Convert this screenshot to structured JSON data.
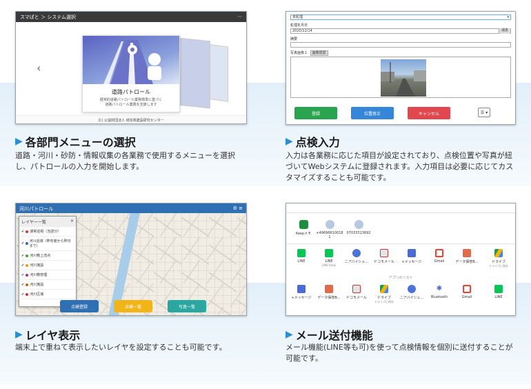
{
  "q1": {
    "breadcrumb": "スマぱと ＞ システム選択",
    "card_title": "道路パトロール",
    "card_sub": "経常的道路パトロール業務標準に基づく\n道路パトロール業務を支援します",
    "footer": "(C) 公益財団法人 岐阜県建設研究センター",
    "heading": "各部門メニューの選択",
    "desc": "道路・河川・砂防・情報収集の各業務で使用するメニューを選択し、パトロールの入力を開始します。"
  },
  "q2": {
    "select_value": "未処理",
    "date_label": "処理年月日",
    "date_value": "2020/12/14",
    "date_btn": "消去",
    "summary_label": "摘要",
    "photo_label": "写真画像１",
    "photo_tag": "画像追加",
    "btn_register": "登録",
    "btn_position": "位置修正",
    "btn_cancel": "キャンセル",
    "btn_menu": "☰ ▾",
    "heading": "点検入力",
    "desc": "入力は各業務に応じた項目が設定されており、点検位置や写真が紐づいてWebシステムに登録されます。入力項目は必要に応じてカスタマイズすることも可能です。"
  },
  "q3": {
    "app_title": "河川パトロール",
    "panel_title": "レイヤー一覧",
    "layers": [
      "通常巡視（当該分）",
      "河川巡視（昨年度から昨日まで）",
      "河川敷上流点",
      "河川施設",
      "河川敷管理",
      "河川施設",
      "河川区域"
    ],
    "btn_register": "点検登録",
    "btn_list": "点検一覧",
    "btn_photos": "写真一覧",
    "heading": "レイヤ表示",
    "desc": "端末上で重ねて表示したいレイヤを設定することも可能です。"
  },
  "q4": {
    "contacts": [
      {
        "name": "Keepメモ",
        "color": "#1e8e3e"
      },
      {
        "name": "+49696610018\n1",
        "color": "#b7c8e2"
      },
      {
        "name": "07033313692",
        "color": "#b7c8e2"
      }
    ],
    "apps_row1": [
      {
        "name": "LINE",
        "sub": "",
        "color": "#06c755"
      },
      {
        "name": "LINE",
        "sub": "LINE Keep",
        "color": "#06c755"
      },
      {
        "name": "ニアバイシェ...",
        "sub": "",
        "color": "#4a73d8"
      },
      {
        "name": "ドコモメール",
        "sub": "",
        "color": "#e4e4e4"
      },
      {
        "name": "+メッセージ",
        "sub": "",
        "color": "#4a6ad8"
      },
      {
        "name": "Gmail",
        "sub": "",
        "color": "#ea4335"
      },
      {
        "name": "データ保管B...",
        "sub": "",
        "color": "#e06a4a"
      },
      {
        "name": "ドライブ",
        "sub": "ドライブに保存",
        "color": "#f4b400"
      }
    ],
    "applist_label": "アプリのリスト",
    "apps_row2": [
      {
        "name": "+メッセージ",
        "color": "#4a6ad8"
      },
      {
        "name": "データ保管B...",
        "color": "#e06a4a"
      },
      {
        "name": "ドコモメール",
        "color": "#e4e4e4"
      },
      {
        "name": "ドライブ",
        "sub": "ドライブに保存",
        "color": "#f4b400"
      },
      {
        "name": "ニアバイシェ...",
        "color": "#4a73d8"
      },
      {
        "name": "Bluetooth",
        "color": "#4a6ad8"
      },
      {
        "name": "Gmail",
        "color": "#ea4335"
      },
      {
        "name": "LINE",
        "color": "#06c755"
      }
    ],
    "heading": "メール送付機能",
    "desc": "メール機能(LINE等も可)を使って点検情報を個別に送付することが可能です。"
  }
}
